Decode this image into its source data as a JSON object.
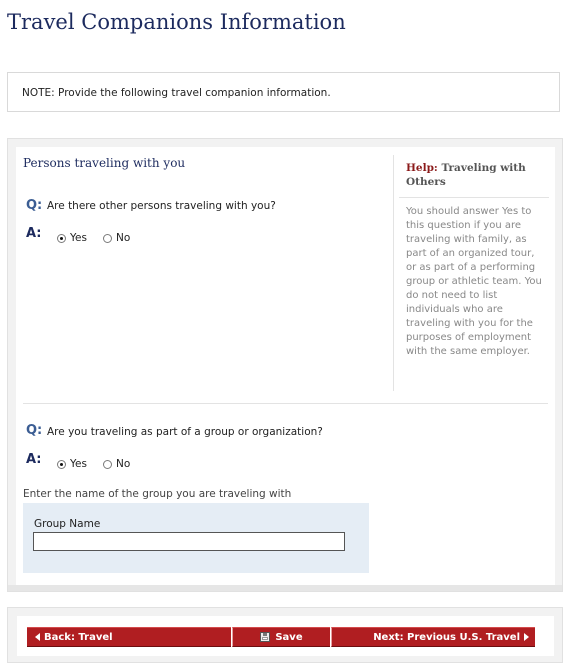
{
  "page": {
    "title": "Travel Companions Information"
  },
  "note": {
    "text": "NOTE: Provide the following travel companion information."
  },
  "section": {
    "title": "Persons traveling with you"
  },
  "questions": [
    {
      "q_mark": "Q:",
      "text": "Are there other persons traveling with you?",
      "a_mark": "A:",
      "options": [
        {
          "label": "Yes",
          "selected": true
        },
        {
          "label": "No",
          "selected": false
        }
      ]
    },
    {
      "q_mark": "Q:",
      "text": "Are you traveling as part of a group or organization?",
      "a_mark": "A:",
      "options": [
        {
          "label": "Yes",
          "selected": true
        },
        {
          "label": "No",
          "selected": false
        }
      ]
    }
  ],
  "help": {
    "label": "Help:",
    "title": "Traveling with Others",
    "body": "You should answer Yes to this question if you are traveling with family, as part of an organized tour, or as part of a performing group or athletic team. You do not need to list individuals who are traveling with you for the purposes of employment with the same employer."
  },
  "group": {
    "instruction": "Enter the name of the group you are traveling with",
    "field_label": "Group Name",
    "field_value": ""
  },
  "nav": {
    "back_label": "Back: Travel",
    "save_label": "Save",
    "next_label": "Next: Previous U.S. Travel"
  },
  "colors": {
    "title": "#1c2a5e",
    "button": "#b01e21",
    "help_label": "#8b1a1a",
    "group_box": "#e5edf5"
  },
  "icons": {
    "back": "arrow-left-icon",
    "save": "floppy-disk-icon",
    "next": "arrow-right-icon"
  }
}
